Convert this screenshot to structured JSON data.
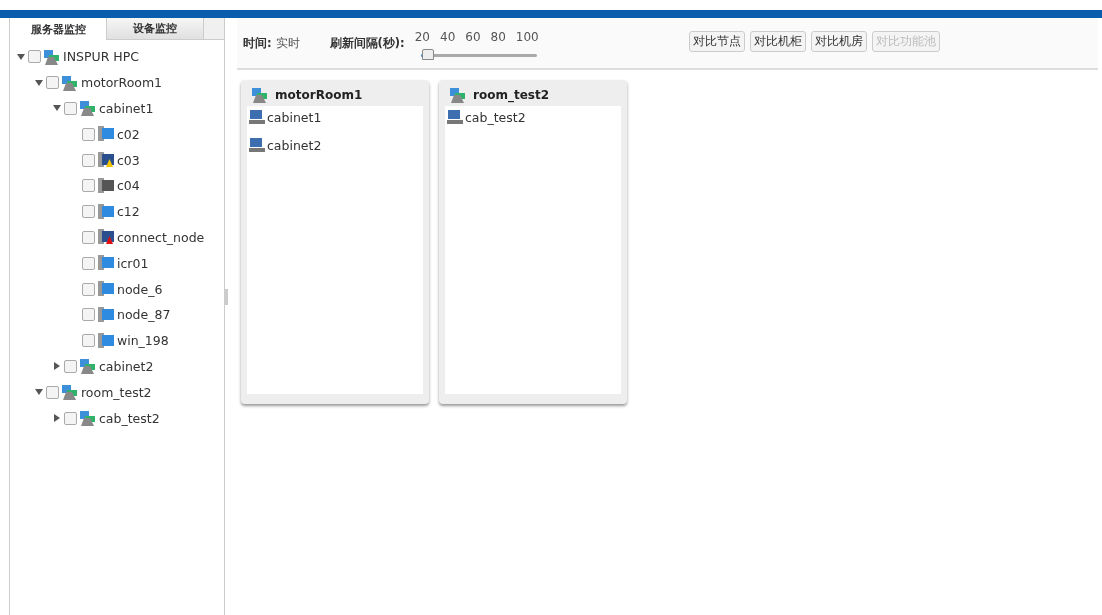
{
  "tabs": [
    {
      "label": "服务器监控",
      "selected": true
    },
    {
      "label": "设备监控",
      "selected": false
    }
  ],
  "tree": [
    {
      "label": "INSPUR HPC",
      "kind": "group",
      "expanded": true,
      "checked": false,
      "children": [
        {
          "label": "motorRoom1",
          "kind": "group",
          "expanded": true,
          "checked": false,
          "children": [
            {
              "label": "cabinet1",
              "kind": "group",
              "expanded": true,
              "checked": false,
              "children": [
                {
                  "label": "c02",
                  "kind": "normal",
                  "checked": false
                },
                {
                  "label": "c03",
                  "kind": "warning",
                  "checked": false
                },
                {
                  "label": "c04",
                  "kind": "offline",
                  "checked": false
                },
                {
                  "label": "c12",
                  "kind": "normal",
                  "checked": false
                },
                {
                  "label": "connect_node",
                  "kind": "error",
                  "checked": false
                },
                {
                  "label": "icr01",
                  "kind": "normal",
                  "checked": false
                },
                {
                  "label": "node_6",
                  "kind": "normal",
                  "checked": false
                },
                {
                  "label": "node_87",
                  "kind": "normal",
                  "checked": false
                },
                {
                  "label": "win_198",
                  "kind": "normal",
                  "checked": false
                }
              ]
            },
            {
              "label": "cabinet2",
              "kind": "group",
              "expanded": false,
              "checked": false
            }
          ]
        },
        {
          "label": "room_test2",
          "kind": "group",
          "expanded": true,
          "checked": false,
          "children": [
            {
              "label": "cab_test2",
              "kind": "group",
              "expanded": false,
              "checked": false
            }
          ]
        }
      ]
    }
  ],
  "toolbar": {
    "time_label": "时间:",
    "time_value": "实时",
    "interval_label": "刷新间隔(秒):",
    "interval_ticks": [
      "20",
      "40",
      "60",
      "80",
      "100"
    ],
    "interval_slider": {
      "level": 0.05
    },
    "buttons": [
      {
        "label": "对比节点",
        "disabled": false
      },
      {
        "label": "对比机柜",
        "disabled": false
      },
      {
        "label": "对比机房",
        "disabled": false
      },
      {
        "label": "对比功能池",
        "disabled": true
      }
    ]
  },
  "rooms": [
    {
      "title": "motorRoom1",
      "cabinets": [
        "cabinet1",
        "cabinet2"
      ]
    },
    {
      "title": "room_test2",
      "cabinets": [
        "cab_test2"
      ]
    }
  ]
}
